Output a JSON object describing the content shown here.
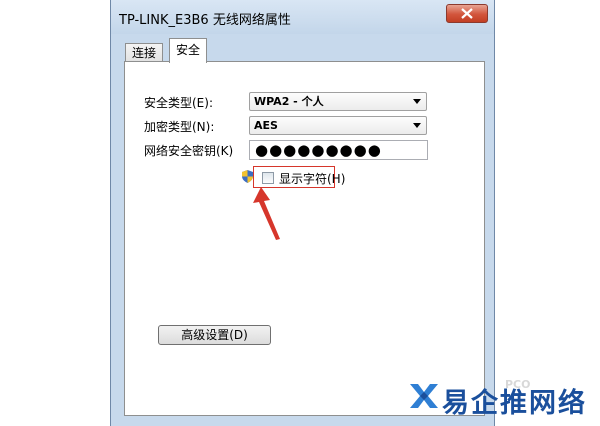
{
  "window": {
    "title": "TP-LINK_E3B6 无线网络属性"
  },
  "tabs": [
    {
      "label": "连接",
      "active": false
    },
    {
      "label": "安全",
      "active": true
    }
  ],
  "security": {
    "type_label": "安全类型(E):",
    "type_value": "WPA2 - 个人",
    "encryption_label": "加密类型(N):",
    "encryption_value": "AES",
    "key_label": "网络安全密钥(K)",
    "key_value": "●●●●●●●●●",
    "show_chars_label": "显示字符(H)",
    "show_chars_checked": false
  },
  "advanced_button": "高级设置(D)",
  "watermark": {
    "text": "易企推网络",
    "faint_text": "PCO"
  },
  "colors": {
    "window_frame": "#c7d9ec",
    "close_button": "#c94a31",
    "annotation_red": "#d6362b",
    "watermark_blue": "#1a4f9c"
  },
  "icons": [
    "close-icon",
    "dropdown-arrow-icon",
    "uac-shield-icon",
    "annotation-arrow-icon",
    "watermark-logo-icon"
  ]
}
